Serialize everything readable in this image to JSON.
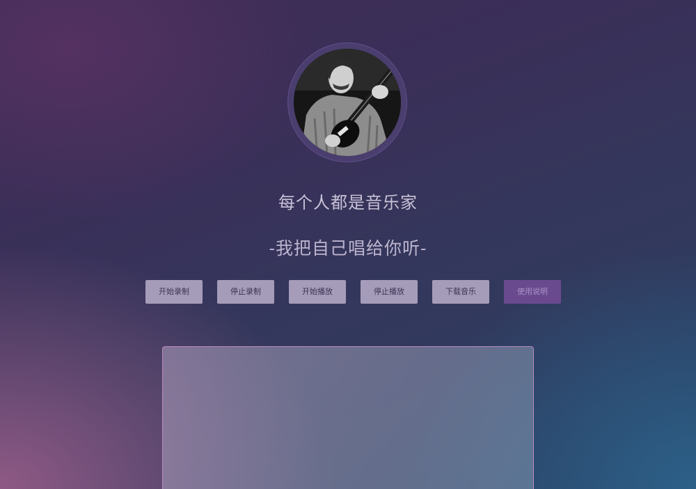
{
  "avatar": {
    "icon": "guitarist-photo"
  },
  "header": {
    "title": "每个人都是音乐家",
    "subtitle": "-我把自己唱给你听-"
  },
  "toolbar": {
    "buttons": [
      {
        "label": "开始录制"
      },
      {
        "label": "停止录制"
      },
      {
        "label": "开始播放"
      },
      {
        "label": "停止播放"
      },
      {
        "label": "下载音乐"
      },
      {
        "label": "使用说明"
      }
    ]
  },
  "colors": {
    "button_bg": "#a59cb9",
    "help_button_bg": "#6a4a8f",
    "panel_border": "#b98bc0"
  }
}
